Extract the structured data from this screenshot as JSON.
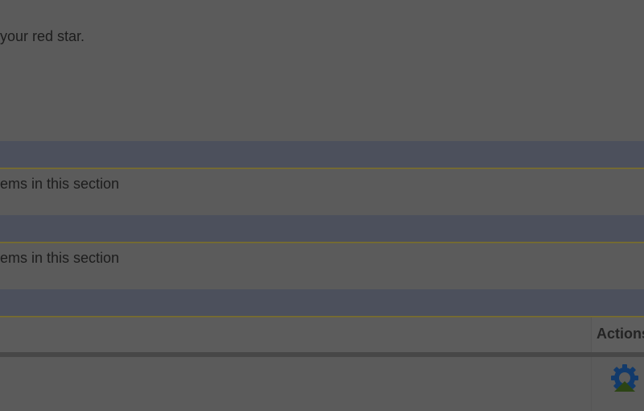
{
  "intro": {
    "text": "your red star."
  },
  "sections": [
    {
      "empty_text": "ems in this section"
    },
    {
      "empty_text": "ems in this section"
    }
  ],
  "table": {
    "actions_header": "Actions"
  },
  "icons": {
    "row_action": "gear-with-up-arrow-icon"
  },
  "colors": {
    "section_header": "#4c505c",
    "section_border": "#7a6e2e",
    "icon_gear": "#123a6b",
    "icon_arrow": "#2c4415"
  }
}
